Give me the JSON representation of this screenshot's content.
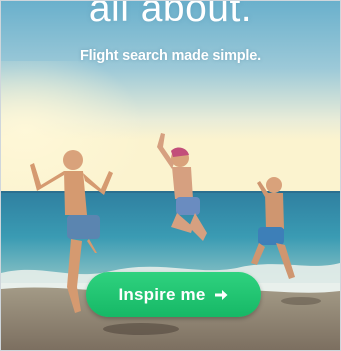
{
  "ad": {
    "headline": "all about.",
    "tagline": "Flight search made simple.",
    "cta": {
      "label": "Inspire me",
      "icon": "arrow-right-icon"
    }
  },
  "colors": {
    "sky_top": "#6fb3cf",
    "sea": "#2a8aa6",
    "sand": "#8a7d6e",
    "cta_green": "#1fc371"
  }
}
